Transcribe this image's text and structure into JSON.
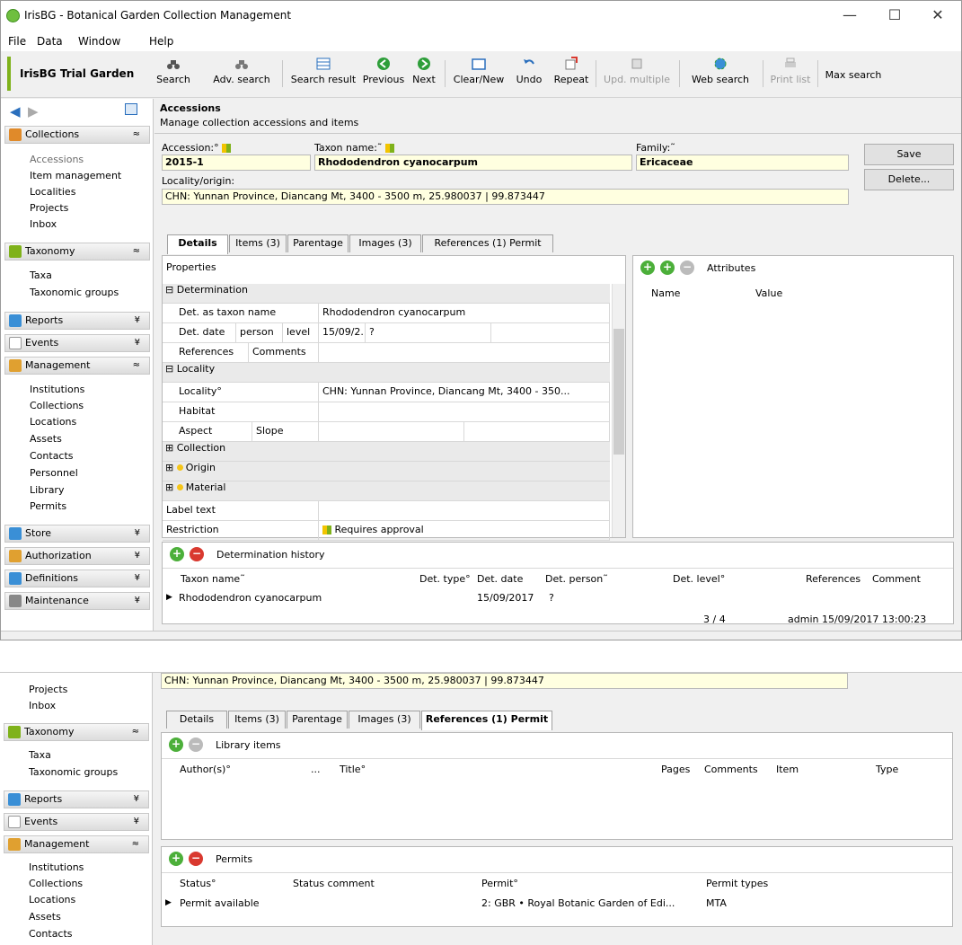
{
  "window": {
    "title": "IrisBG - Botanical Garden Collection Management",
    "minimize": "—",
    "maximize": "☐",
    "close": "✕"
  },
  "menu": [
    "File",
    "Data",
    "Window",
    "Help"
  ],
  "garden_name": "IrisBG Trial Garden",
  "toolbar": {
    "search": "Search",
    "adv_search": "Adv. search",
    "search_result": "Search result",
    "previous": "Previous",
    "next": "Next",
    "clear_new": "Clear/New",
    "undo": "Undo",
    "repeat": "Repeat",
    "upd_multiple": "Upd. multiple",
    "web_search": "Web search",
    "print_list": "Print list",
    "max_search": "Max search"
  },
  "sidebar": {
    "collections": {
      "label": "Collections",
      "items": [
        "Accessions",
        "Item management",
        "Localities",
        "Projects",
        "Inbox"
      ]
    },
    "taxonomy": {
      "label": "Taxonomy",
      "items": [
        "Taxa",
        "Taxonomic groups"
      ]
    },
    "reports": "Reports",
    "events": "Events",
    "management": {
      "label": "Management",
      "items": [
        "Institutions",
        "Collections",
        "Locations",
        "Assets",
        "Contacts",
        "Personnel",
        "Library",
        "Permits"
      ]
    },
    "store": "Store",
    "authorization": "Authorization",
    "definitions": "Definitions",
    "maintenance": "Maintenance",
    "chevron_up": "≈",
    "chevron_down": "¥"
  },
  "header": {
    "title": "Accessions",
    "subtitle": "Manage collection accessions and items"
  },
  "form": {
    "accession_label": "Accession:°",
    "accession": "2015-1",
    "taxon_label": "Taxon name:˜",
    "taxon": "Rhododendron cyanocarpum",
    "family_label": "Family:˜",
    "family": "Ericaceae",
    "locality_label": "Locality/origin:",
    "locality": "CHN: Yunnan Province, Diancang Mt, 3400 - 3500 m, 25.980037 | 99.873447",
    "save": "Save",
    "delete": "Delete..."
  },
  "tabs": [
    "Details",
    "Items (3)",
    "Parentage",
    "Images (3)",
    "References (1) Permit"
  ],
  "properties": {
    "header": "Properties",
    "determination": "Determination",
    "det_taxon_label": "Det. as taxon name",
    "det_taxon": "Rhododendron cyanocarpum",
    "det_date_label": "Det. date",
    "det_person_label": "person",
    "det_level_label": "level",
    "det_date": "15/09/2...",
    "det_person": "?",
    "references_label": "References",
    "comments_label": "Comments",
    "locality_cat": "Locality",
    "locality_label": "Locality°",
    "locality_value": "CHN: Yunnan Province, Diancang Mt, 3400 - 350...",
    "habitat_label": "Habitat",
    "aspect_label": "Aspect",
    "slope_label": "Slope",
    "collection_cat": "Collection",
    "origin_cat": "Origin",
    "material_cat": "Material",
    "label_text": "Label text",
    "restriction_label": "Restriction",
    "restriction_value": "Requires approval"
  },
  "attributes": {
    "header": "Attributes",
    "name_col": "Name",
    "value_col": "Value"
  },
  "det_history": {
    "header": "Determination history",
    "cols": [
      "Taxon name˜",
      "Det. type°",
      "Det. date",
      "Det. person˜",
      "Det. level°",
      "References",
      "Comment"
    ],
    "row": {
      "taxon": "Rhododendron cyanocarpum",
      "date": "15/09/2017",
      "person": "?"
    }
  },
  "status": {
    "record": "3 / 4",
    "user": "admin 15/09/2017 13:00:23"
  },
  "crop2": {
    "library_header": "Library items",
    "library_cols": [
      "Author(s)°",
      "...",
      "Title°",
      "Pages",
      "Comments",
      "Item",
      "Type"
    ],
    "permits_header": "Permits",
    "permit_cols": [
      "Status°",
      "Status comment",
      "Permit°",
      "Permit types"
    ],
    "permit_row": {
      "status": "Permit available",
      "permit": "2: GBR • Royal Botanic Garden of Edi...",
      "types": "MTA"
    }
  }
}
